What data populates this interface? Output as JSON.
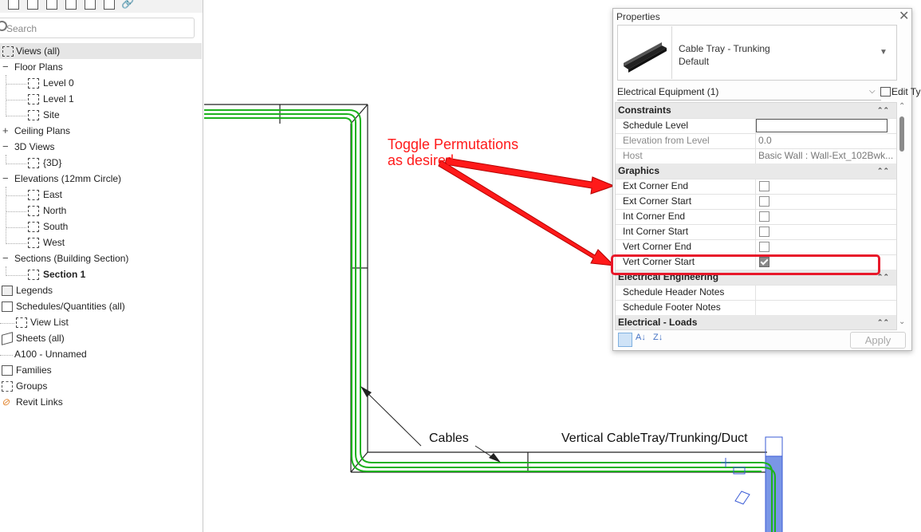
{
  "browser": {
    "search_placeholder": "Search",
    "root": "Views (all)",
    "floor_plans": "Floor Plans",
    "level0": "Level 0",
    "level1": "Level 1",
    "site": "Site",
    "ceiling_plans": "Ceiling Plans",
    "views3d": "3D Views",
    "view3d": "{3D}",
    "elevations": "Elevations (12mm Circle)",
    "east": "East",
    "north": "North",
    "south": "South",
    "west": "West",
    "sections": "Sections (Building Section)",
    "section1": "Section 1",
    "legends": "Legends",
    "schedules": "Schedules/Quantities (all)",
    "view_list": "View List",
    "sheets": "Sheets (all)",
    "sheet_a100": "A100 - Unnamed",
    "families": "Families",
    "groups": "Groups",
    "revit_links": "Revit Links",
    "expand_minus": "−",
    "expand_plus": "+"
  },
  "canvas": {
    "note_line1": "Toggle Permutations",
    "note_line2": "as desired",
    "label_cables": "Cables",
    "label_vertical": "Vertical CableTray/Trunking/Duct"
  },
  "props": {
    "title": "Properties",
    "close": "✕",
    "type_name_line1": "Cable Tray - Trunking",
    "type_name_line2": "Default",
    "filter": "Electrical Equipment (1)",
    "edit_type": "Edit Type",
    "constraints": "Constraints",
    "schedule_level": "Schedule Level",
    "elevation_from_level": "Elevation from Level",
    "elevation_value": "0.0",
    "host": "Host",
    "host_value": "Basic Wall : Wall-Ext_102Bwk...",
    "graphics": "Graphics",
    "ext_corner_end": "Ext Corner End",
    "ext_corner_start": "Ext Corner Start",
    "int_corner_end": "Int Corner End",
    "int_corner_start": "Int Corner Start",
    "vert_corner_end": "Vert Corner End",
    "vert_corner_start": "Vert Corner Start",
    "electrical_engineering": "Electrical Engineering",
    "schedule_header_notes": "Schedule Header Notes",
    "schedule_footer_notes": "Schedule Footer Notes",
    "electrical_loads": "Electrical - Loads",
    "apply": "Apply",
    "checkbox_states": {
      "ext_corner_end": false,
      "ext_corner_start": false,
      "int_corner_end": false,
      "int_corner_start": false,
      "vert_corner_end": false,
      "vert_corner_start": true
    }
  },
  "colors": {
    "cable_green": "#1db21d",
    "annotation_red": "#ff1a1a",
    "highlight_red": "#e8182a",
    "duct_blue": "#7a96e6"
  }
}
